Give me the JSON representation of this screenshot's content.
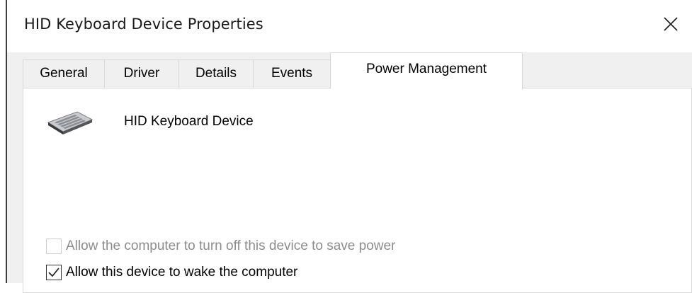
{
  "window": {
    "title": "HID Keyboard Device Properties"
  },
  "tabs": [
    {
      "label": "General",
      "active": false
    },
    {
      "label": "Driver",
      "active": false
    },
    {
      "label": "Details",
      "active": false
    },
    {
      "label": "Events",
      "active": false
    },
    {
      "label": "Power Management",
      "active": true
    }
  ],
  "device": {
    "name": "HID Keyboard Device",
    "icon": "keyboard-icon"
  },
  "options": [
    {
      "label": "Allow the computer to turn off this device to save power",
      "checked": false,
      "enabled": false
    },
    {
      "label": "Allow this device to wake the computer",
      "checked": true,
      "enabled": true
    }
  ]
}
